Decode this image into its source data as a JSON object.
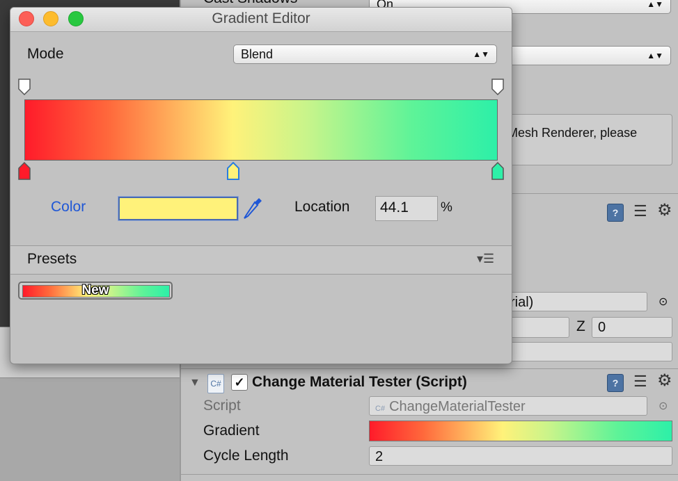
{
  "editor": {
    "title": "Gradient Editor",
    "mode_label": "Mode",
    "mode_value": "Blend",
    "color_label": "Color",
    "selected_color": "#fff27a",
    "location_label": "Location",
    "location_value": "44.1",
    "location_unit": "%",
    "presets_label": "Presets",
    "preset_new_label": "New",
    "gradient_stops": [
      {
        "location": 0,
        "color": "#ff1b2a"
      },
      {
        "location": 44.1,
        "color": "#fff27a"
      },
      {
        "location": 100,
        "color": "#2df0a8"
      }
    ],
    "alpha_stops": [
      {
        "location": 0,
        "alpha": 1.0
      },
      {
        "location": 100,
        "alpha": 1.0
      }
    ]
  },
  "inspector": {
    "cast_shadows_label": "Cast Shadows",
    "cast_shadows_value": "On",
    "help_text": "Mesh Renderer, please",
    "material_value": "rial)",
    "z_label": "Z",
    "z_value": "0",
    "component_title": "Change Material Tester (Script)",
    "component_enabled": true,
    "script_label": "Script",
    "script_value": "ChangeMaterialTester",
    "gradient_label": "Gradient",
    "cycle_length_label": "Cycle Length",
    "cycle_length_value": "2"
  },
  "colors": {
    "accent_blue": "#1f57d6",
    "gradient_start": "#ff1b2a",
    "gradient_mid": "#fff27a",
    "gradient_end": "#2df0a8"
  }
}
